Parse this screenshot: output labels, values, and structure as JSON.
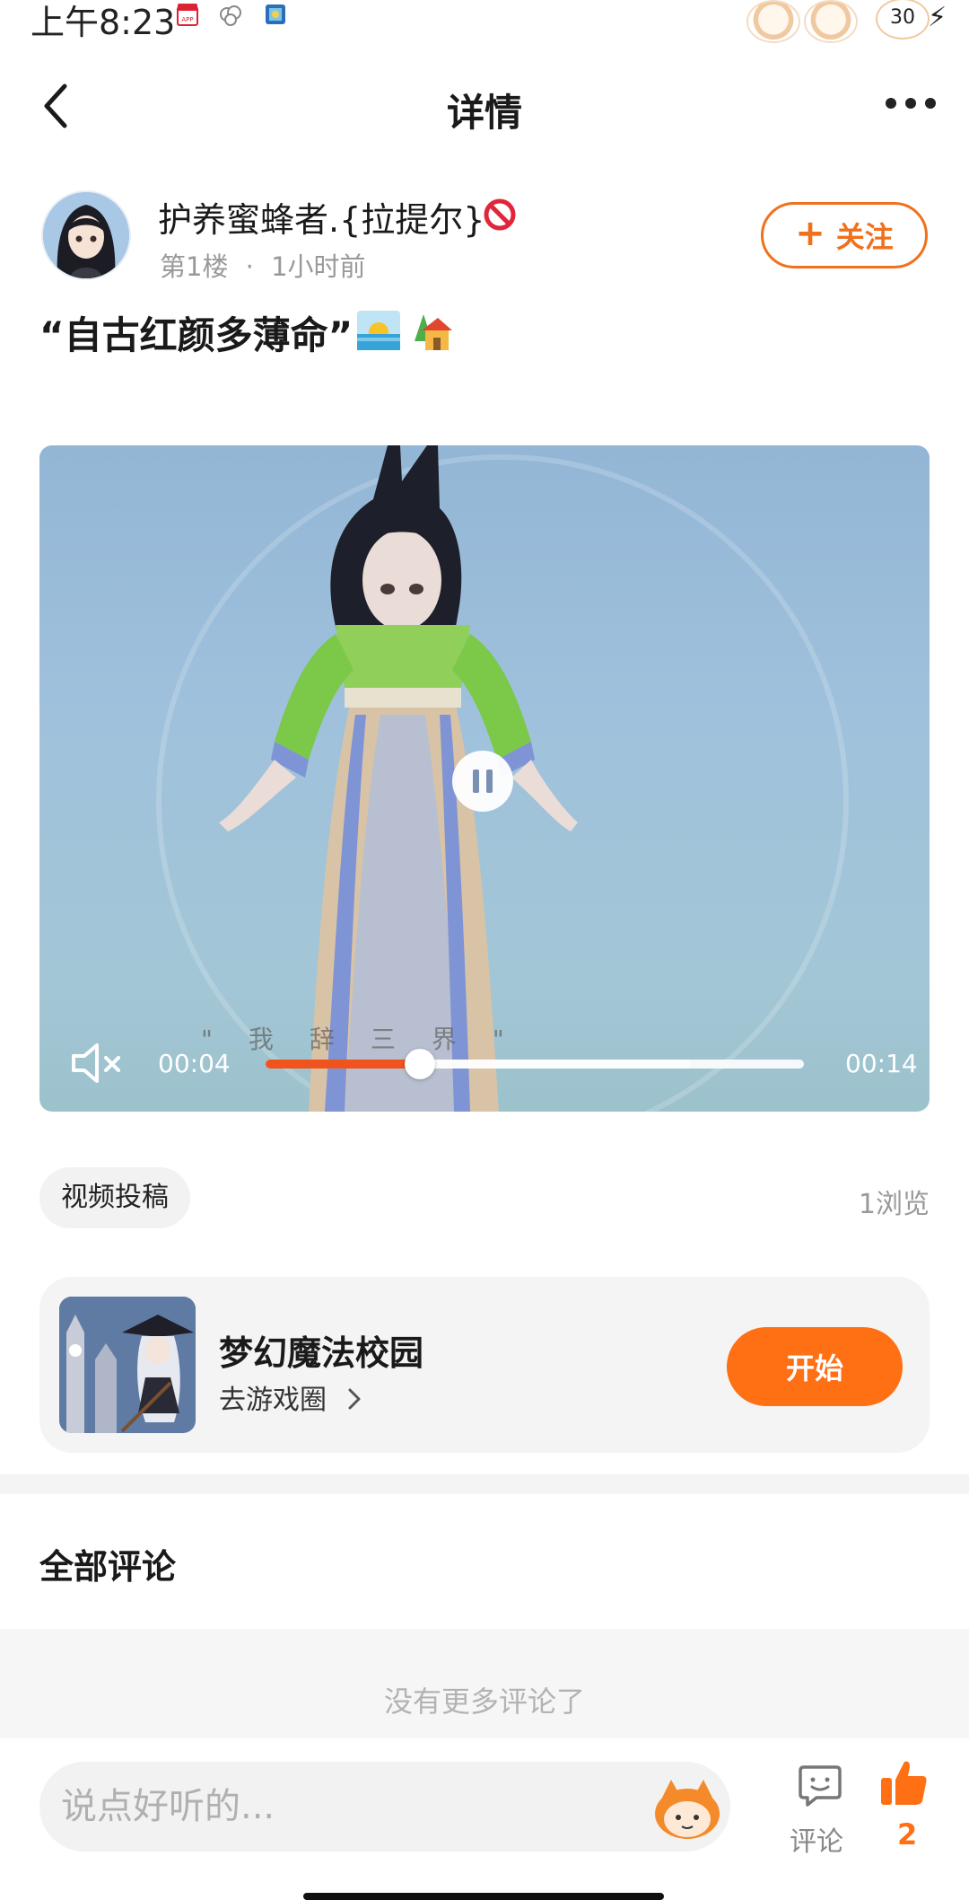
{
  "status_bar": {
    "time": "上午8:23",
    "battery": "30",
    "icons": [
      "app-store-icon",
      "cloud-icon",
      "gallery-icon",
      "avatar-icon",
      "avatar-icon",
      "charging-icon"
    ]
  },
  "header": {
    "title": "详情",
    "back_icon": "chevron-left-icon",
    "more_icon": "more-dots-icon"
  },
  "post": {
    "author": {
      "name": "护养蜜蜂者.{拉提尔}",
      "floor": "第1楼",
      "time_ago": "1小时前",
      "follow_label": "关注",
      "follow_icon": "plus-icon"
    },
    "title": "“自古红颜多薄命”",
    "video": {
      "current_time": "00:04",
      "total_time": "00:14",
      "progress": 0.286,
      "buffered": 0.79,
      "subtitle": "\"我辞三界\"",
      "muted": true
    },
    "tag": "视频投稿",
    "views": "1浏览"
  },
  "game": {
    "name": "梦幻魔法校园",
    "link": "去游戏圈",
    "start_label": "开始"
  },
  "comments": {
    "header": "全部评论",
    "empty_text": "没有更多评论了"
  },
  "bottom_bar": {
    "placeholder": "说点好听的...",
    "comment_label": "评论",
    "like_count": "2"
  },
  "colors": {
    "accent": "#ff6f14",
    "progress": "#f0531c",
    "muted_text": "#999999"
  }
}
